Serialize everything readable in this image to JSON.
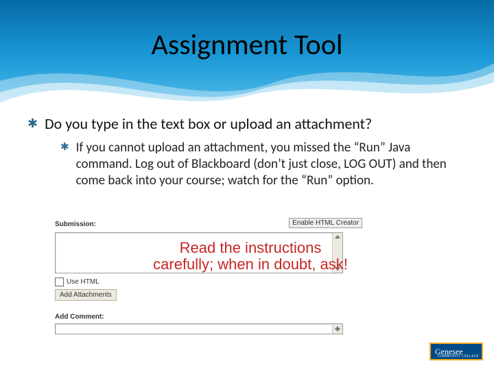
{
  "title": "Assignment Tool",
  "bullets": {
    "l1": "Do you type in the text box or upload an attachment?",
    "l2": "If you cannot upload an attachment, you missed the “Run” Java command. Log out of Blackboard (don’t just close, LOG OUT) and then come back into your course; watch for the “Run” option."
  },
  "screenshot": {
    "submission_label": "Submission:",
    "enable_html_button": "Enable HTML Creator",
    "use_html_checkbox": "Use HTML",
    "add_attachments_button": "Add Attachments",
    "add_comment_label": "Add Comment:"
  },
  "callout_text": "Read the instructions carefully; when in doubt, ask!",
  "logo": {
    "name": "Genesee",
    "sub": "COMMUNITY COLLEGE"
  }
}
